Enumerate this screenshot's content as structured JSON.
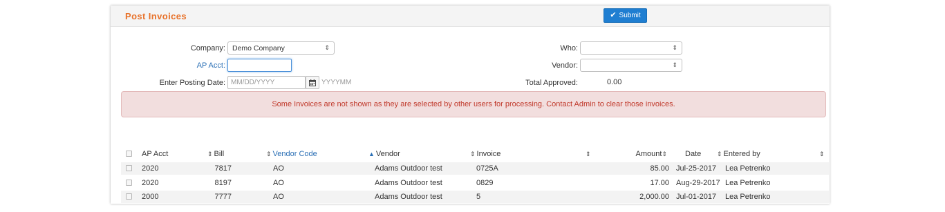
{
  "header": {
    "title": "Post Invoices",
    "submit_label": "Submit"
  },
  "form": {
    "company_label": "Company:",
    "company_value": "Demo Company",
    "ap_acct_label": "AP Acct:",
    "ap_acct_value": "",
    "posting_date_label": "Enter Posting Date:",
    "posting_date_placeholder": "MM/DD/YYYY",
    "posting_date_hint": "YYYYMM",
    "who_label": "Who:",
    "who_value": "",
    "vendor_label": "Vendor:",
    "vendor_value": "",
    "total_approved_label": "Total Approved:",
    "total_approved_value": "0.00"
  },
  "alert": {
    "message": "Some Invoices are not shown as they are selected by other users for processing. Contact Admin to clear those invoices."
  },
  "table": {
    "columns": {
      "ap_acct": "AP Acct",
      "bill": "Bill",
      "vendor_code": "Vendor Code",
      "vendor": "Vendor",
      "invoice": "Invoice",
      "amount": "Amount",
      "date": "Date",
      "entered_by": "Entered by"
    },
    "rows": [
      {
        "ap_acct": "2020",
        "bill": "7817",
        "vendor_code": "AO",
        "vendor": "Adams Outdoor test",
        "invoice": "0725A",
        "amount": "85.00",
        "date": "Jul-25-2017",
        "entered_by": "Lea Petrenko"
      },
      {
        "ap_acct": "2020",
        "bill": "8197",
        "vendor_code": "AO",
        "vendor": "Adams Outdoor test",
        "invoice": "0829",
        "amount": "17.00",
        "date": "Aug-29-2017",
        "entered_by": "Lea Petrenko"
      },
      {
        "ap_acct": "2000",
        "bill": "7777",
        "vendor_code": "AO",
        "vendor": "Adams Outdoor test",
        "invoice": "5",
        "amount": "2,000.00",
        "date": "Jul-01-2017",
        "entered_by": "Lea Petrenko"
      }
    ]
  },
  "colors": {
    "accent_orange": "#e8722a",
    "primary_blue": "#1f7ed1",
    "alert_bg": "#f2dede",
    "alert_text": "#c0392b"
  }
}
